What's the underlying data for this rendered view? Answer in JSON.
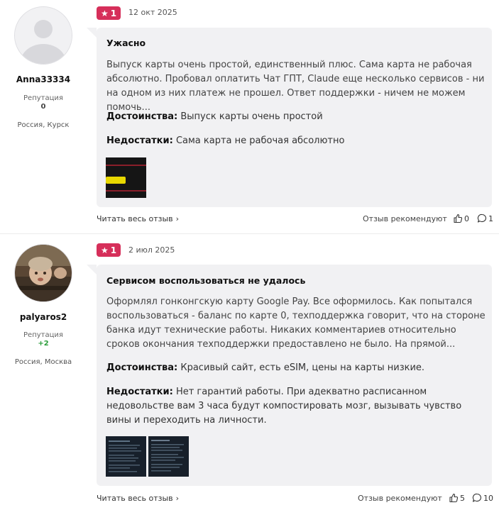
{
  "reviews": [
    {
      "author": {
        "name": "Anna33334",
        "reputation_label": "Репутация",
        "reputation": "0",
        "location": "Россия, Курск",
        "avatar": "default-avatar"
      },
      "rating": "1",
      "date": "12 окт 2025",
      "title": "Ужасно",
      "text": "Выпуск карты очень простой, единственный плюс. Сама карта не рабочая абсолютно. Пробовал оплатить Чат ГПТ, Claude еще несколько сервисов - ни на одном из них платеж не прошел. Ответ поддержки - ничем не можем помочь...",
      "pros_label": "Достоинства:",
      "pros": "Выпуск карты очень простой",
      "cons_label": "Недостатки:",
      "cons": "Сама карта не рабочая абсолютно",
      "read_more": "Читать весь отзыв",
      "recommend": "Отзыв рекомендуют",
      "likes": "0",
      "comments": "1"
    },
    {
      "author": {
        "name": "palyaros2",
        "reputation_label": "Репутация",
        "reputation": "+2",
        "location": "Россия, Москва",
        "avatar": "child-photo-avatar"
      },
      "rating": "1",
      "date": "2 июл 2025",
      "title": "Сервисом воспользоваться не удалось",
      "text": "Оформлял гонконгскую карту Google Pay. Все оформилось. Как попытался воспользоваться - баланс по карте 0, техподдержка говорит, что на стороне банка идут технические работы. Никаких комментариев относительно сроков окончания техподдержки предоставлено не было. На прямой...",
      "pros_label": "Достоинства:",
      "pros": "Красивый сайт, есть eSIM, цены на карты низкие.",
      "cons_label": "Недостатки:",
      "cons": "Нет гарантий работы. При адекватно расписанном недовольстве вам 3 часа будут компостировать мозг, вызывать чувство вины и переходить на личности.",
      "read_more": "Читать весь отзыв",
      "recommend": "Отзыв рекомендуют",
      "likes": "5",
      "comments": "10"
    }
  ],
  "colors": {
    "badge": "#d62f5a",
    "bubble": "#f1f1f3",
    "positive": "#2a9d3a"
  }
}
